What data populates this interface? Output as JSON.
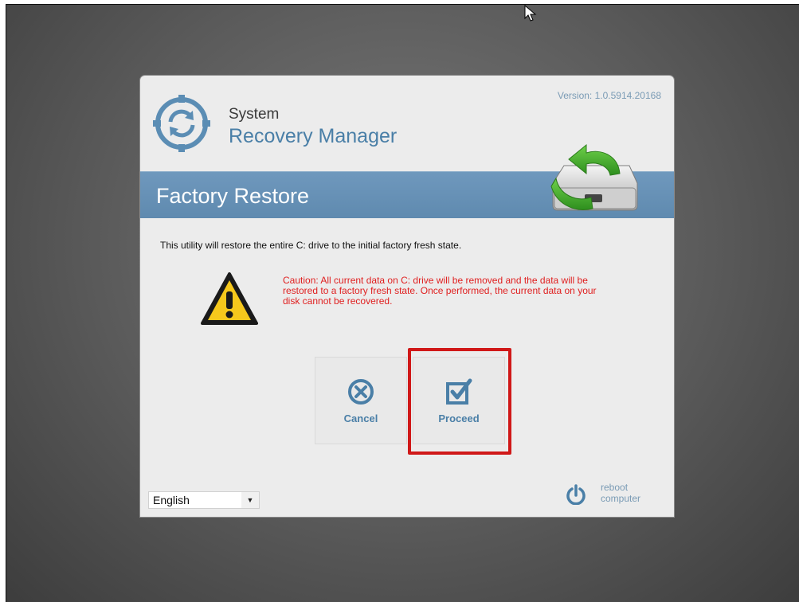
{
  "app": {
    "subtitle": "System",
    "title": "Recovery Manager",
    "version": "Version: 1.0.5914.20168"
  },
  "banner": {
    "title": "Factory Restore"
  },
  "content": {
    "intro": "This utility will restore the entire C: drive to the initial factory fresh state.",
    "caution": "Caution: All current data on C: drive will be removed and the data will be restored to a factory fresh state. Once performed, the current data on your disk cannot be recovered."
  },
  "buttons": {
    "cancel": {
      "label": "Cancel",
      "icon": "cancel-circle-icon"
    },
    "proceed": {
      "label": "Proceed",
      "icon": "checkbox-icon"
    }
  },
  "language": {
    "selected": "English"
  },
  "reboot": {
    "line1": "reboot",
    "line2": "computer",
    "icon": "power-icon"
  },
  "colors": {
    "accent": "#4a7fa7",
    "banner": "#6f98bd",
    "caution": "#e02020",
    "highlight": "#d01818"
  }
}
